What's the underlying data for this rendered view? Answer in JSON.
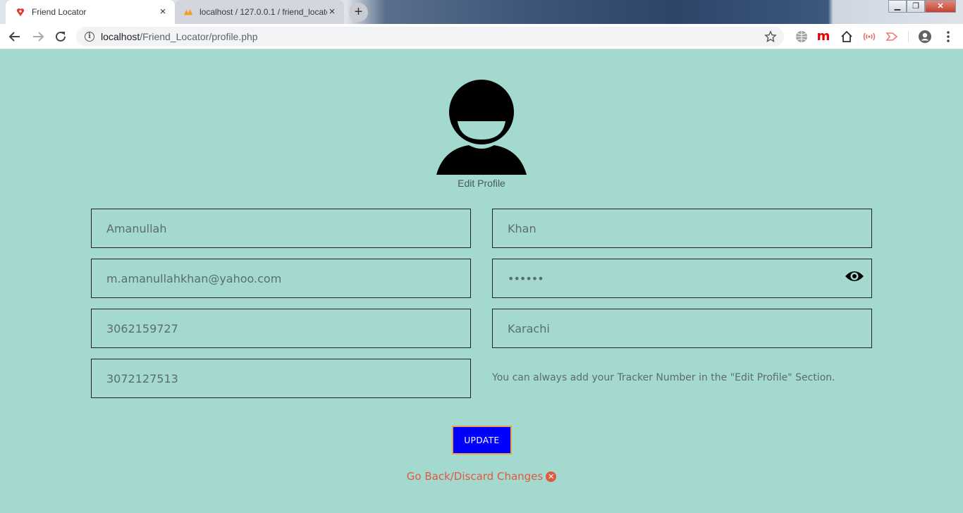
{
  "browser": {
    "tabs": [
      {
        "title": "Friend Locator",
        "active": true
      },
      {
        "title": "localhost / 127.0.0.1 / friend_locator",
        "active": false
      }
    ],
    "address": {
      "host": "localhost",
      "path": "/Friend_Locator/profile.php"
    },
    "accent": "#1a73e8"
  },
  "profile": {
    "caption": "Edit Profile"
  },
  "form": {
    "first_name": {
      "placeholder": "Amanullah"
    },
    "last_name": {
      "placeholder": "Khan"
    },
    "email": {
      "placeholder": "m.amanullahkhan@yahoo.com"
    },
    "password": {
      "value": "••••••"
    },
    "phone": {
      "placeholder": "3062159727"
    },
    "city": {
      "placeholder": "Karachi"
    },
    "tracker": {
      "placeholder": "3072127513"
    },
    "hint": "You can always add your Tracker Number in the \"Edit Profile\" Section.",
    "update_label": "UPDATE",
    "go_back_label": "Go Back/Discard Changes"
  },
  "colors": {
    "background": "#a3d9cf",
    "update_button": "#0000ff",
    "update_border": "#e6a14a",
    "go_back": "#e0593f"
  },
  "icons": [
    "heart-map-pin-icon",
    "phpmyadmin-icon",
    "info-icon",
    "star-icon",
    "globe-icon",
    "m-icon",
    "home-icon",
    "cast-icon",
    "redirect-icon",
    "account-icon",
    "menu-icon",
    "eye-icon",
    "close-circle-icon"
  ]
}
